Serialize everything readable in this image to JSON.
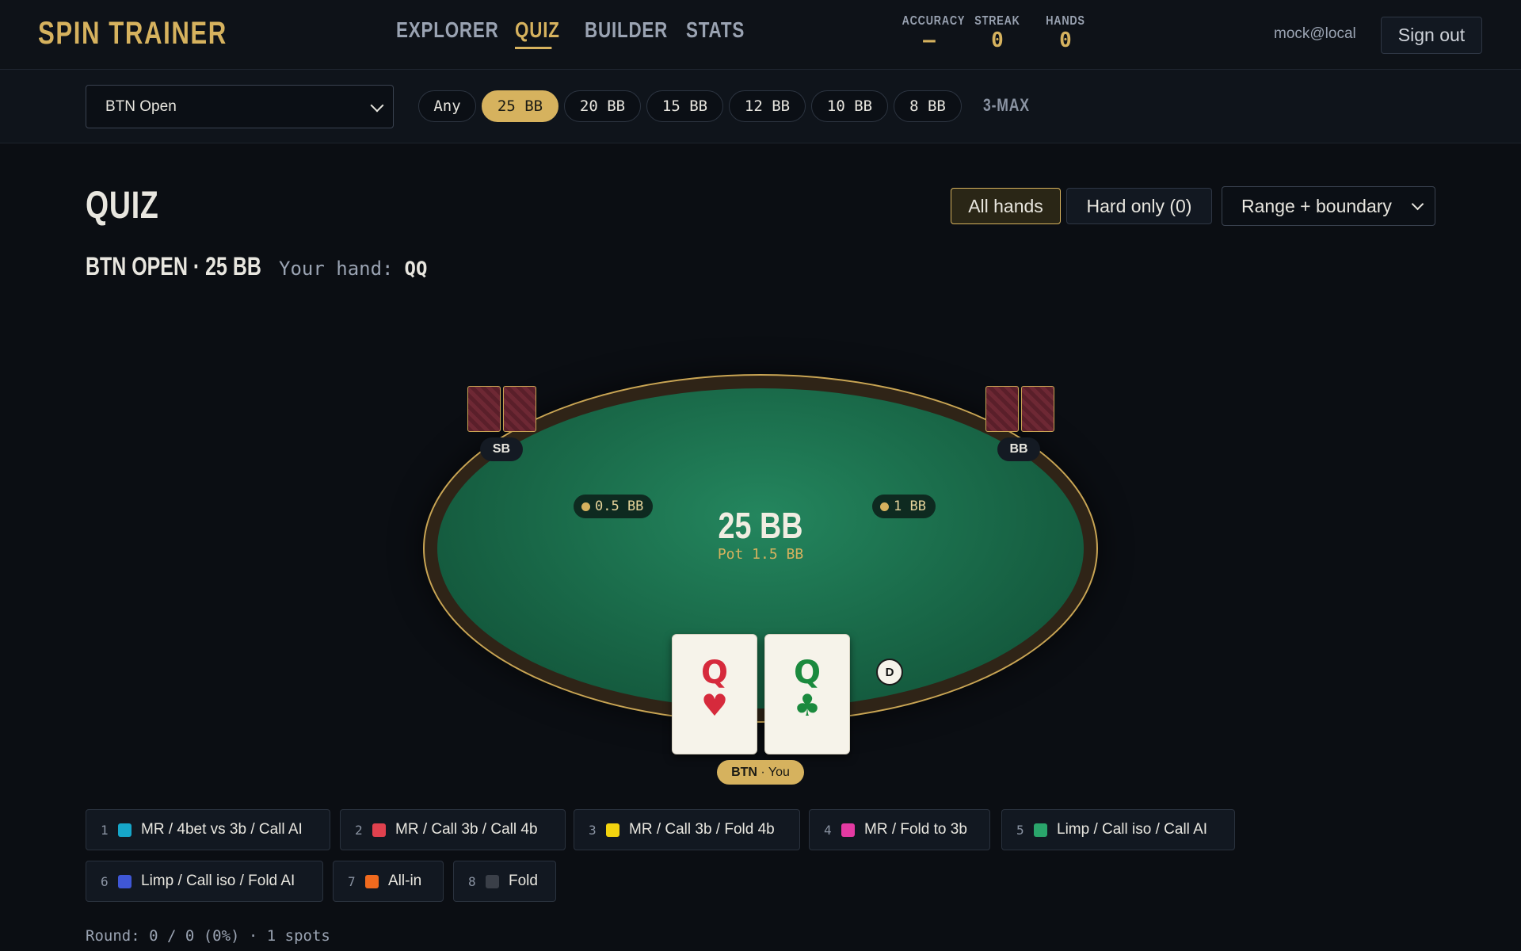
{
  "app": {
    "brand": "SPIN TRAINER",
    "nav": [
      {
        "label": "EXPLORER",
        "active": false
      },
      {
        "label": "QUIZ",
        "active": true
      },
      {
        "label": "BUILDER",
        "active": false
      },
      {
        "label": "STATS",
        "active": false
      }
    ],
    "stats": [
      {
        "label": "ACCURACY",
        "value": "–"
      },
      {
        "label": "STREAK",
        "value": "0"
      },
      {
        "label": "HANDS",
        "value": "0"
      }
    ],
    "user": "mock@local",
    "signout_label": "Sign out"
  },
  "filters": {
    "spot_selected": "BTN Open",
    "depths": [
      {
        "label": "Any",
        "active": false
      },
      {
        "label": "25 BB",
        "active": true
      },
      {
        "label": "20 BB",
        "active": false
      },
      {
        "label": "15 BB",
        "active": false
      },
      {
        "label": "12 BB",
        "active": false
      },
      {
        "label": "10 BB",
        "active": false
      },
      {
        "label": "8 BB",
        "active": false
      }
    ],
    "format": "3-MAX"
  },
  "quiz": {
    "title": "QUIZ",
    "mode_all": "All hands",
    "mode_hard": "Hard only (0)",
    "view_selected": "Range + boundary",
    "spot_name": "BTN OPEN · 25 BB",
    "hand_label": "Your hand:",
    "hand_value": "QQ"
  },
  "table": {
    "stack": "25 BB",
    "pot": "Pot 1.5 BB",
    "sb": {
      "label": "SB",
      "bet": "0.5 BB"
    },
    "bb": {
      "label": "BB",
      "bet": "1 BB"
    },
    "dealer": "D",
    "hero": {
      "position": "BTN",
      "suffix": "· You",
      "cards": [
        {
          "rank": "Q",
          "suit": "♥",
          "color": "#d62a3c"
        },
        {
          "rank": "Q",
          "suit": "♣",
          "color": "#1b8a3e"
        }
      ]
    }
  },
  "actions": [
    {
      "key": "1",
      "label": "MR / 4bet vs 3b / Call AI",
      "color": "#16a6c9"
    },
    {
      "key": "2",
      "label": "MR / Call 3b / Call 4b",
      "color": "#e0414e"
    },
    {
      "key": "3",
      "label": "MR / Call 3b / Fold 4b",
      "color": "#f2d30f"
    },
    {
      "key": "4",
      "label": "MR / Fold to 3b",
      "color": "#e43aa2"
    },
    {
      "key": "5",
      "label": "Limp / Call iso / Call AI",
      "color": "#2aa56b"
    },
    {
      "key": "6",
      "label": "Limp / Call iso / Fold AI",
      "color": "#3f57d6"
    },
    {
      "key": "7",
      "label": "All-in",
      "color": "#f06a1e"
    },
    {
      "key": "8",
      "label": "Fold",
      "color": "#3a3f48"
    }
  ],
  "round": "Round: 0 / 0 (0%) · 1 spots"
}
